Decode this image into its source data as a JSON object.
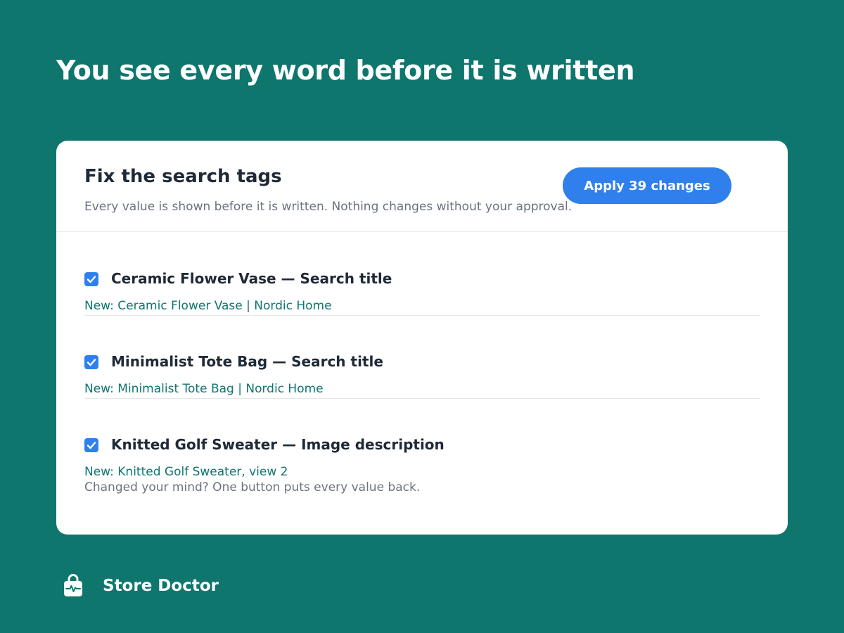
{
  "page": {
    "headline": "You see every word before it is written"
  },
  "card": {
    "title": "Fix the search tags",
    "subtitle": "Every value is shown before it is written. Nothing changes without your approval.",
    "apply_button_label": "Apply 39 changes"
  },
  "changes": [
    {
      "checked": true,
      "title": "Ceramic Flower Vase — Search title",
      "new_value": "New: Ceramic Flower Vase | Nordic Home"
    },
    {
      "checked": true,
      "title": "Minimalist Tote Bag — Search title",
      "new_value": "New: Minimalist Tote Bag | Nordic Home"
    },
    {
      "checked": true,
      "title": "Knitted Golf Sweater — Image description",
      "new_value": "New: Knitted Golf Sweater, view 2",
      "note": "Changed your mind? One button puts every value back."
    }
  ],
  "brand": {
    "name": "Store Doctor",
    "icon": "shopping-bag-pulse-icon"
  },
  "colors": {
    "background": "#0f766e",
    "accent": "#2f80ed",
    "new_value_text": "#0f766e",
    "muted_text": "#6b7280"
  }
}
